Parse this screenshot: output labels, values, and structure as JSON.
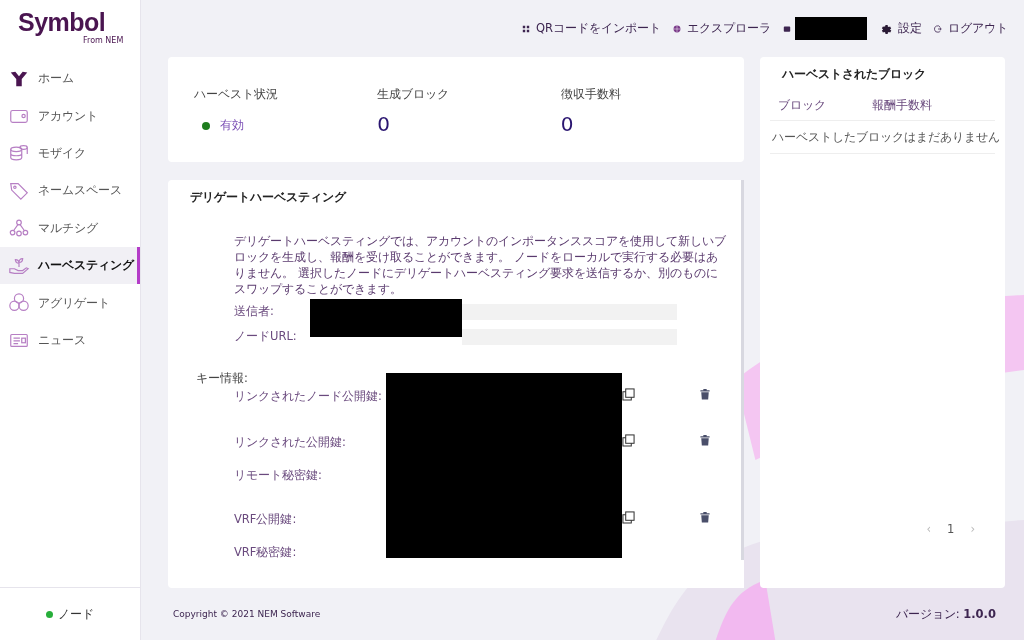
{
  "logo": {
    "name": "Symbol",
    "tagline": "From NEM"
  },
  "sidebar": {
    "items": [
      {
        "label": "ホーム",
        "selected": false
      },
      {
        "label": "アカウント",
        "selected": false
      },
      {
        "label": "モザイク",
        "selected": false
      },
      {
        "label": "ネームスペース",
        "selected": false
      },
      {
        "label": "マルチシグ",
        "selected": false
      },
      {
        "label": "ハーベスティング",
        "selected": true
      },
      {
        "label": "アグリゲート",
        "selected": false
      },
      {
        "label": "ニュース",
        "selected": false
      }
    ],
    "node": {
      "label": "ノード",
      "online": true
    }
  },
  "header": {
    "links": [
      "QRコードをインポート",
      "エクスプローラ"
    ],
    "settings": "設定",
    "logout": "ログアウト"
  },
  "stats": {
    "status_label": "ハーベスト状況",
    "status_value": "有効",
    "status_active": true,
    "blocks_label": "生成ブロック",
    "blocks_value": "0",
    "fees_label": "徴収手数料",
    "fees_value": "0"
  },
  "delegated": {
    "title": "デリゲートハーベスティング",
    "description": "デリゲートハーベスティングでは、アカウントのインポータンススコアを使用して新しいブロックを生成し、報酬を受け取ることができます。 ノードをローカルで実行する必要はありません。 選択したノードにデリゲートハーベスティング要求を送信するか、別のものにスワップすることができます。",
    "fields": [
      {
        "label": "送信者:"
      },
      {
        "label": "ノードURL:"
      }
    ],
    "key_info_label": "キー情報:",
    "keys": [
      {
        "label": "リンクされたノード公開鍵:",
        "actions": true
      },
      {
        "label": "リンクされた公開鍵:",
        "actions": true
      },
      {
        "label": "リモート秘密鍵:",
        "actions": false
      },
      {
        "label": "VRF公開鍵:",
        "actions": true
      },
      {
        "label": "VRF秘密鍵:",
        "actions": false
      }
    ]
  },
  "harvested": {
    "title": "ハーベストされたブロック",
    "columns": [
      "ブロック",
      "報酬手数料"
    ],
    "empty": "ハーベストしたブロックはまだありません",
    "pagination": {
      "prev": "‹",
      "page": "1",
      "next": "›"
    }
  },
  "footer": {
    "copyright": "Copyright © 2021 NEM Software",
    "version": "バージョン: **1.0.0**"
  }
}
